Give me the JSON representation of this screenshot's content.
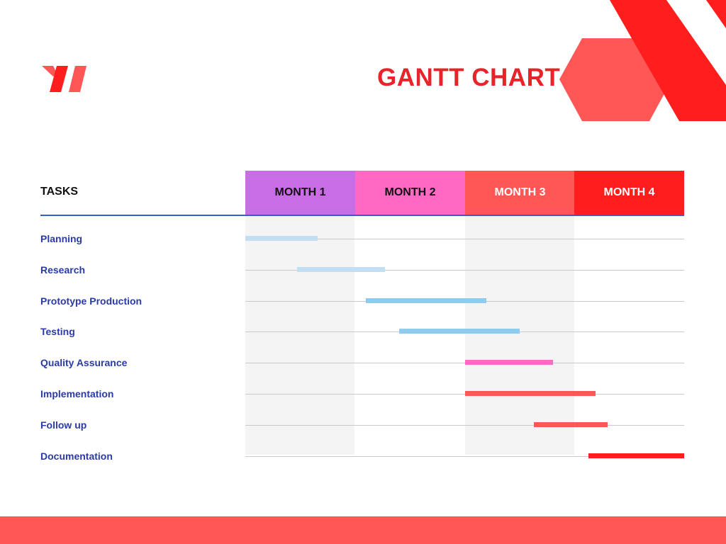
{
  "header": {
    "title": "GANTT CHART"
  },
  "brand": {
    "logo_icon": "twin-parallelogram-logo-icon",
    "primary_red": "#FF1E1E",
    "secondary_red": "#FF5656"
  },
  "table": {
    "tasks_label": "TASKS"
  },
  "chart_data": {
    "type": "gantt",
    "title": "GANTT CHART",
    "x_unit": "month",
    "xlim": [
      0,
      4
    ],
    "months": [
      {
        "label": "MONTH 1",
        "header_color": "#C86DE6",
        "text_color": "#111111"
      },
      {
        "label": "MONTH 2",
        "header_color": "#FF69C4",
        "text_color": "#111111"
      },
      {
        "label": "MONTH 3",
        "header_color": "#FF5656",
        "text_color": "#ffffff"
      },
      {
        "label": "MONTH 4",
        "header_color": "#FF1E1E",
        "text_color": "#ffffff"
      }
    ],
    "tasks": [
      {
        "name": "Planning",
        "start": 0.0,
        "end": 0.66,
        "color": "#C2DEF2"
      },
      {
        "name": "Research",
        "start": 0.47,
        "end": 1.27,
        "color": "#C2DEF2"
      },
      {
        "name": "Prototype Production",
        "start": 1.1,
        "end": 2.2,
        "color": "#8FCBEE"
      },
      {
        "name": "Testing",
        "start": 1.4,
        "end": 2.5,
        "color": "#8FCBEE"
      },
      {
        "name": "Quality Assurance",
        "start": 2.0,
        "end": 2.8,
        "color": "#FF69C4"
      },
      {
        "name": "Implementation",
        "start": 2.0,
        "end": 3.19,
        "color": "#FF5656"
      },
      {
        "name": "Follow up",
        "start": 2.63,
        "end": 3.3,
        "color": "#FF5656"
      },
      {
        "name": "Documentation",
        "start": 3.13,
        "end": 4.0,
        "color": "#FF1E1E"
      }
    ]
  }
}
